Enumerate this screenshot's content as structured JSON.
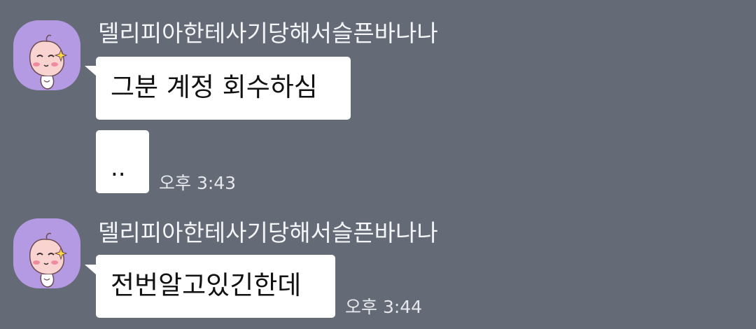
{
  "messages": [
    {
      "sender": "델리피아한테사기당해서슬픈바나나",
      "avatar_icon": "apeach-icon",
      "bubbles": [
        "그분 계정 회수하심",
        ".."
      ],
      "time": "오후 3:43"
    },
    {
      "sender": "델리피아한테사기당해서슬픈바나나",
      "avatar_icon": "apeach-icon",
      "bubbles": [
        "전번알고있긴한데"
      ],
      "time": "오후 3:44"
    }
  ],
  "colors": {
    "background": "#646a76",
    "avatar_bg": "#b49ae3",
    "bubble": "#ffffff",
    "name_text": "#f4f5f7",
    "time_text": "#e6e8ec"
  }
}
